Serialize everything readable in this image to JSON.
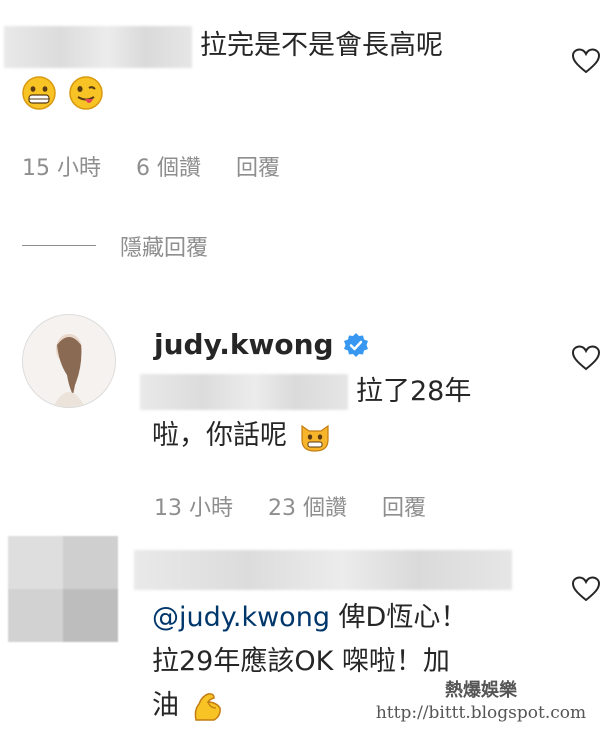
{
  "comment1": {
    "text": "拉完是不是會長高呢",
    "emojis": [
      "grinning-face-emoji",
      "tongue-face-emoji"
    ],
    "time": "15 小時",
    "likes": "6 個讚",
    "reply_label": "回覆"
  },
  "hide_replies_label": "隱藏回覆",
  "reply1": {
    "username": "judy.kwong",
    "verified": true,
    "text_line1": "拉了28年",
    "text_line2": "啦，你話呢",
    "emoji": "grinning-cat-emoji",
    "time": "13 小時",
    "likes": "23 個讚",
    "reply_label": "回覆"
  },
  "reply2": {
    "mention": "@judy.kwong",
    "text_line1": "俾D恆心！",
    "text_line2": "拉29年應該OK 㗎啦！加",
    "text_line3": "油",
    "emoji": "flexed-biceps-emoji"
  },
  "watermark": {
    "title": "熱爆娛樂",
    "url": "http://bittt.blogspot.com"
  },
  "colors": {
    "text": "#262626",
    "meta": "#8e8e8e",
    "mention": "#00376b",
    "verified": "#3897f0"
  }
}
